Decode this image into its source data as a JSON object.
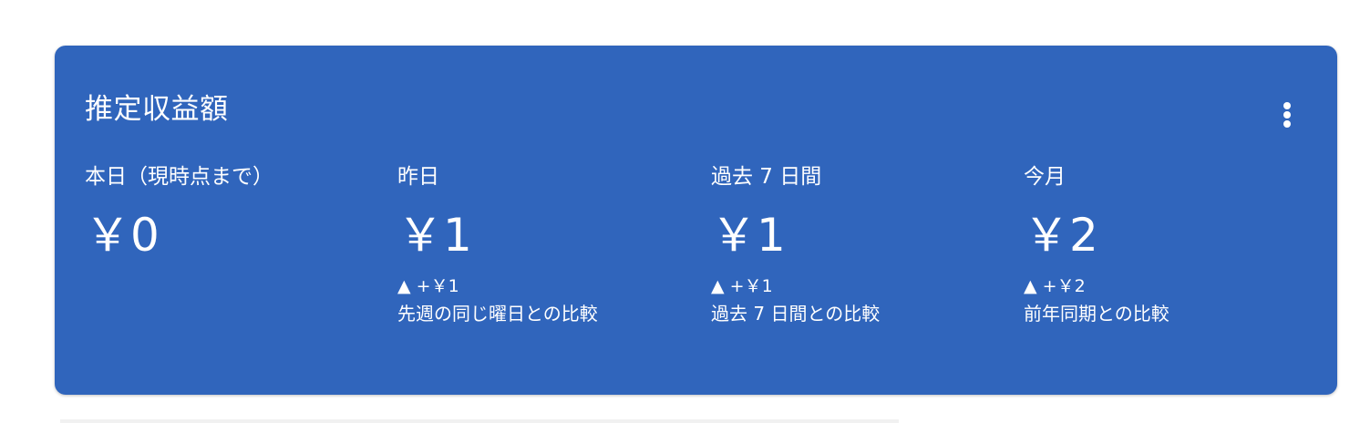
{
  "card": {
    "title": "推定収益額",
    "more_menu_icon": "more-vert-icon",
    "background_color": "#3065BC"
  },
  "metrics": [
    {
      "label": "本日（現時点まで）",
      "value": "￥0",
      "change": "",
      "compare": ""
    },
    {
      "label": "昨日",
      "value": "￥1",
      "change": "▲ +￥1",
      "compare": "先週の同じ曜日との比較"
    },
    {
      "label": "過去 7 日間",
      "value": "￥1",
      "change": "▲ +￥1",
      "compare": "過去 7 日間との比較"
    },
    {
      "label": "今月",
      "value": "￥2",
      "change": "▲ +￥2",
      "compare": "前年同期との比較"
    }
  ]
}
